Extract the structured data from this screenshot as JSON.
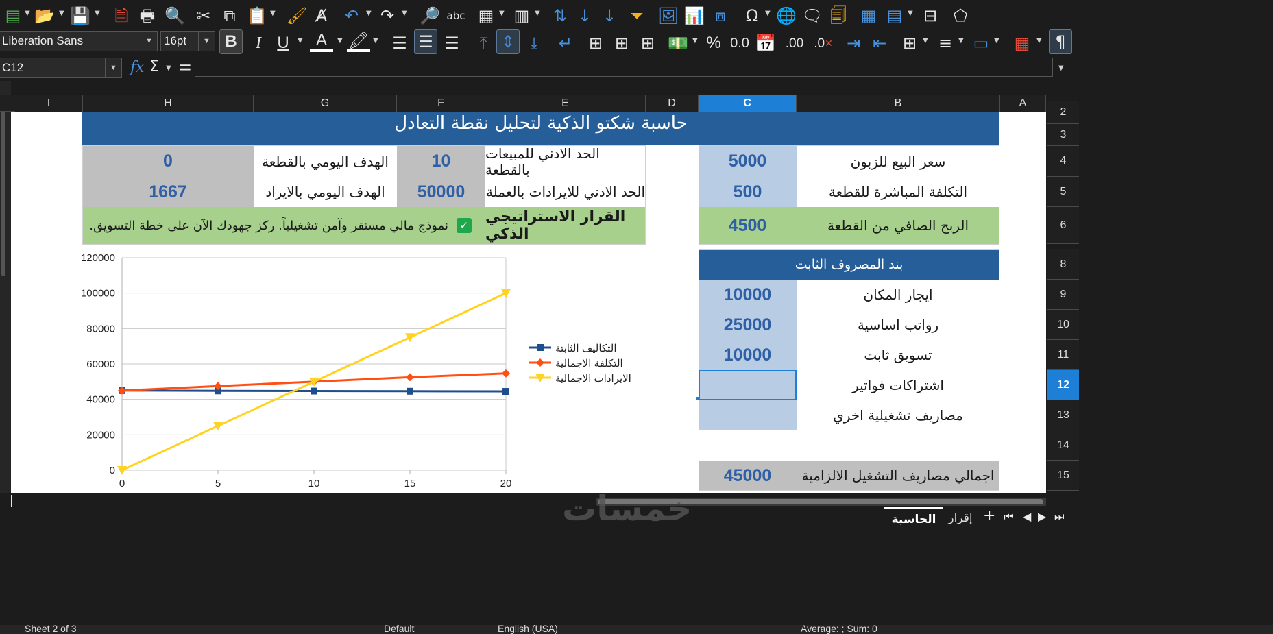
{
  "toolbar": {
    "font_name": "Liberation Sans",
    "font_size": "16pt",
    "bold_label": "B",
    "italic_label": "I",
    "underline_label": "U",
    "font_color_label": "A",
    "percent_label": "%",
    "number_label": "0.0",
    "decimal_add_label": ".00",
    "decimal_remove_label": ".0",
    "spell_label": "abc"
  },
  "formula_bar": {
    "name_box": "C12",
    "fx_label": "fx",
    "sum_label": "Σ",
    "equals_label": "=",
    "content": ""
  },
  "columns": [
    "I",
    "H",
    "G",
    "F",
    "E",
    "D",
    "C",
    "B",
    "A"
  ],
  "rows": [
    "2",
    "3",
    "4",
    "5",
    "6",
    "8",
    "9",
    "10",
    "11",
    "12",
    "13",
    "14",
    "15"
  ],
  "sheet": {
    "title": "حاسبة شكتو الذكية لتحليل نقطة التعادل",
    "selling_price_label": "سعر البيع للزبون",
    "selling_price_value": "5000",
    "direct_cost_label": "التكلفة المباشرة للقطعة",
    "direct_cost_value": "500",
    "net_profit_label": "الربح الصافي من القطعة",
    "net_profit_value": "4500",
    "min_units_label": "الحد الادني للمبيعات بالقطعة",
    "min_units_value": "10",
    "min_revenue_label": "الحد الادني للايرادات بالعملة",
    "min_revenue_value": "50000",
    "daily_units_label": "الهدف اليومي بالقطعة",
    "daily_units_value": "0",
    "daily_revenue_label": "الهدف اليومي بالايراد",
    "daily_revenue_value": "1667",
    "decision_label": "القرار الاستراتيجي الذكي",
    "decision_text": ".نموذج مالي مستقر وآمن تشغيلياً. ركز جهودك الآن على خطة التسويق",
    "fixed_header": "بند المصروف الثابت",
    "fixed_items": [
      {
        "label": "ايجار المكان",
        "value": "10000"
      },
      {
        "label": "رواتب اساسية",
        "value": "25000"
      },
      {
        "label": "تسويق ثابت",
        "value": "10000"
      },
      {
        "label": "اشتراكات فواتير",
        "value": ""
      },
      {
        "label": "مصاريف تشغيلية اخري",
        "value": ""
      }
    ],
    "total_label": "اجمالي مصاريف التشغيل الالزامية",
    "total_value": "45000"
  },
  "chart_data": {
    "type": "line",
    "x": [
      0,
      5,
      10,
      15,
      20
    ],
    "xlim": [
      0,
      20
    ],
    "ylim": [
      0,
      120000
    ],
    "yticks": [
      0,
      20000,
      40000,
      60000,
      80000,
      100000,
      120000
    ],
    "grid": true,
    "legend_position": "right",
    "series": [
      {
        "name": "التكاليف الثابتة",
        "color": "#1f4e8c",
        "marker": "square",
        "values": [
          45000,
          44800,
          44700,
          44600,
          44500
        ]
      },
      {
        "name": "التكلفة الاجمالية",
        "color": "#ff4f14",
        "marker": "diamond",
        "values": [
          45000,
          47500,
          50000,
          52500,
          54700
        ]
      },
      {
        "name": "الايرادات الاجمالية",
        "color": "#ffd320",
        "marker": "triangle",
        "values": [
          0,
          25000,
          50000,
          75000,
          100000
        ]
      }
    ]
  },
  "tabs": [
    {
      "label": "الحاسبة",
      "active": true
    },
    {
      "label": "إقرار",
      "active": false
    }
  ],
  "watermark": "خمسات",
  "statusbar": {
    "sheet_info": "Sheet 2 of 3",
    "style": "Default",
    "language": "English (USA)",
    "summary": "Average: ; Sum: 0"
  }
}
